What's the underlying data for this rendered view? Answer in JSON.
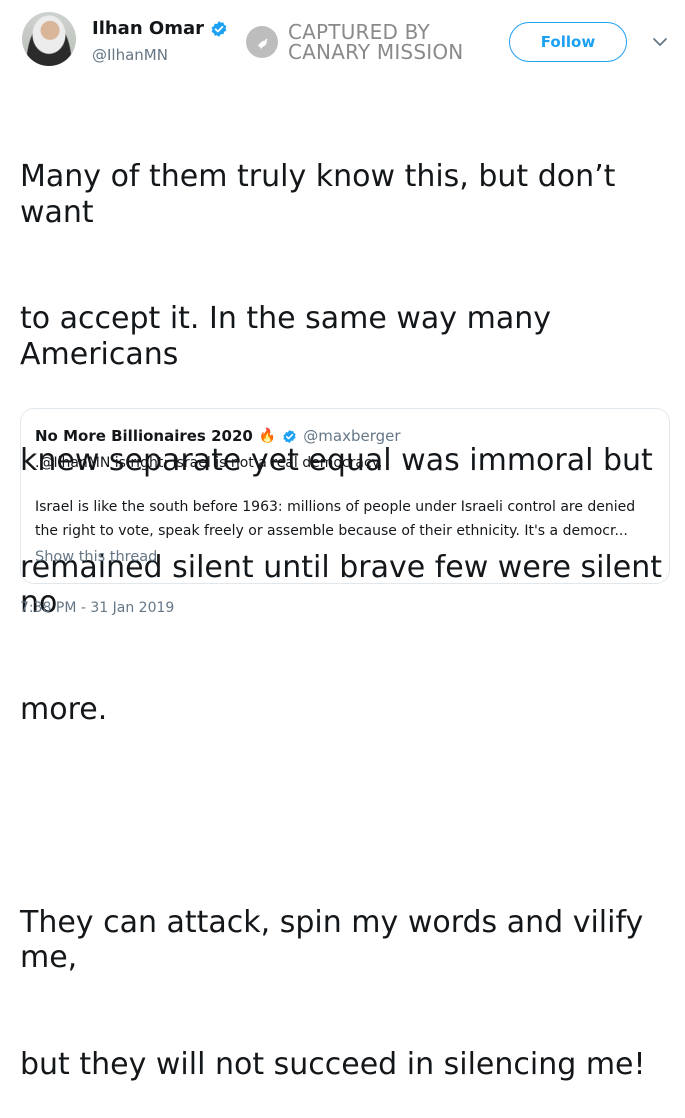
{
  "author": {
    "display_name": "Ilhan Omar",
    "handle": "@IlhanMN",
    "avatar_icon": "profile-photo-avatar",
    "verified_icon": "verified-badge-icon"
  },
  "watermark": {
    "line1": "CAPTURED BY",
    "line2": "CANARY MISSION",
    "logo_icon": "canary-bird-icon"
  },
  "actions": {
    "follow_label": "Follow",
    "menu_icon": "chevron-down-icon"
  },
  "tweet": {
    "paragraphs": [
      "Many of them truly know this, but don’t want to accept it. In the same way many Americans knew separate yet equal was immoral but remained silent until brave few were silent no more.",
      "They can attack, spin my words and vilify me, but they will not succeed in silencing me!"
    ],
    "lines": [
      "Many of them truly know this, but don’t want",
      "to accept it. In the same way many Americans",
      "knew separate yet equal was immoral but",
      "remained silent until brave few were silent no",
      "more.",
      "",
      "They can attack, spin my words and vilify me,",
      "but they will not succeed in silencing me!"
    ],
    "timestamp": "7:38 PM - 31 Jan 2019"
  },
  "quoted_tweet": {
    "display_name": "No More Billionaires 2020",
    "emoji_icon": "fire-emoji-icon",
    "handle": "@maxberger",
    "line1": ".@IlhanMN is right: Israel is not a real democracy.",
    "line2": "Israel is like the south before 1963: millions of people under Israeli control are denied",
    "line3": "the right to vote, speak freely or assemble because of their ethnicity. It's a democr...",
    "show_thread_label": "Show this thread"
  },
  "colors": {
    "accent": "#1da1f2",
    "secondary_text": "#657786",
    "primary_text": "#14171a",
    "border": "#e1e8ed",
    "watermark": "#8a8a8a"
  }
}
